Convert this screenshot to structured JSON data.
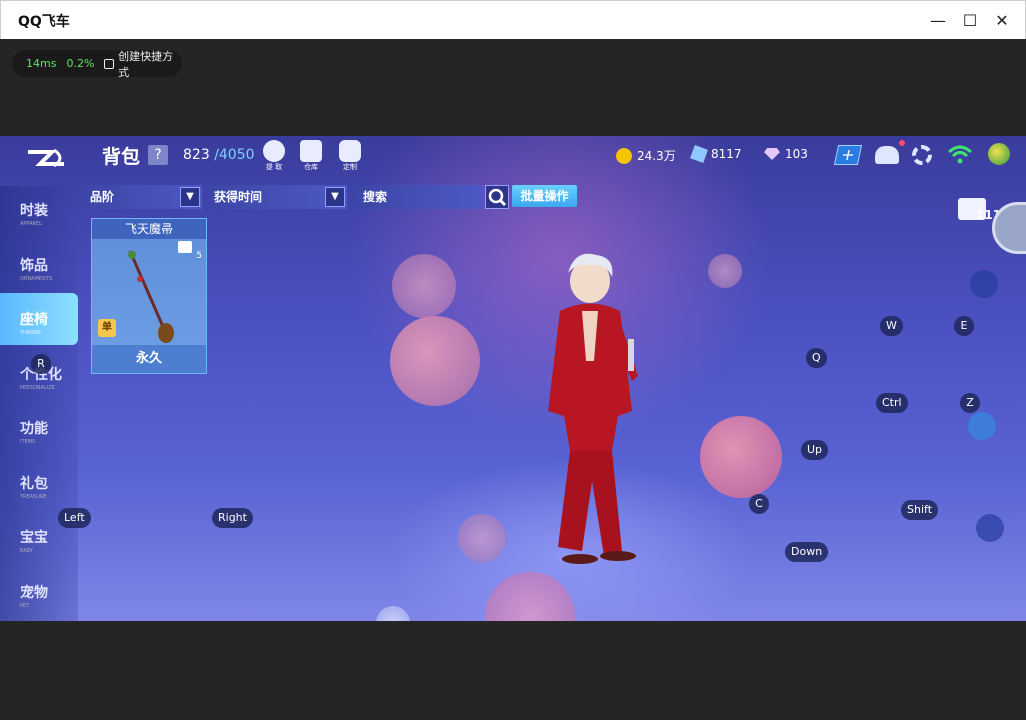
{
  "window": {
    "title": "QQ飞车"
  },
  "status": {
    "latency": "14ms",
    "loss": "0.2%",
    "shortcut_label": "创建快捷方式"
  },
  "header": {
    "title": "背包",
    "help": "?",
    "capacity_used": "823",
    "capacity_max": "/4050",
    "icons": [
      {
        "label": "提 取",
        "icon": "lightbulb-icon"
      },
      {
        "label": "仓库",
        "icon": "warehouse-icon"
      },
      {
        "label": "定制",
        "icon": "customize-icon"
      }
    ],
    "coins": "24.3万",
    "coupons": "8117",
    "diamonds": "103"
  },
  "sidebar": {
    "items": [
      {
        "zh": "时装",
        "en": "APPAREL"
      },
      {
        "zh": "饰品",
        "en": "ORNAMENTS"
      },
      {
        "zh": "座椅",
        "en": "THRONE"
      },
      {
        "zh": "个性化",
        "en": "PERSONALIZE"
      },
      {
        "zh": "功能",
        "en": "ITEMS"
      },
      {
        "zh": "礼包",
        "en": "TREASURE"
      },
      {
        "zh": "宝宝",
        "en": "BABY"
      },
      {
        "zh": "宠物",
        "en": "PET"
      }
    ],
    "active_index": 2
  },
  "filters": {
    "grade": "品阶",
    "time": "获得时间",
    "search_placeholder": "搜索",
    "batch": "批量操作"
  },
  "item": {
    "name": "飞天魔帚",
    "level": "5",
    "tag": "单",
    "duration": "永久"
  },
  "outfit_count": "111",
  "keys": {
    "r": "R",
    "left": "Left",
    "right": "Right",
    "w": "W",
    "e": "E",
    "q": "Q",
    "ctrl": "Ctrl",
    "z": "Z",
    "up": "Up",
    "c": "C",
    "shift": "Shift",
    "down": "Down"
  },
  "colors": {
    "accent": "#5ab8ff",
    "batch": "#3aa7f0",
    "latency": "#5fe35f"
  }
}
